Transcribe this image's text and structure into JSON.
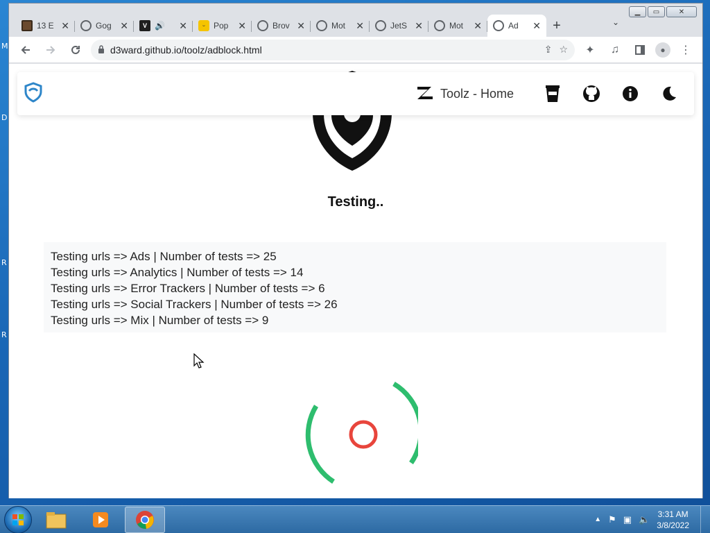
{
  "desktop": {
    "side_letters": [
      "M",
      "D",
      "R",
      "R"
    ]
  },
  "browser": {
    "tabs": [
      {
        "title": "13 E",
        "icon": "game-icon",
        "active": false
      },
      {
        "title": "Gog",
        "icon": "globe-icon",
        "active": false
      },
      {
        "title": "V",
        "icon": "vim-icon",
        "active": false
      },
      {
        "title": "Pop",
        "icon": "smile-icon",
        "active": false
      },
      {
        "title": "Brov",
        "icon": "globe-icon",
        "active": false
      },
      {
        "title": "Mot",
        "icon": "globe-icon",
        "active": false
      },
      {
        "title": "JetS",
        "icon": "globe-icon",
        "active": false
      },
      {
        "title": "Mot",
        "icon": "globe-icon",
        "active": false
      },
      {
        "title": "Ad",
        "icon": "globe-icon",
        "active": true
      }
    ],
    "url": "d3ward.github.io/toolz/adblock.html"
  },
  "page": {
    "nav": {
      "home_label": "Toolz - Home"
    },
    "status": "Testing..",
    "log": [
      "Testing urls => Ads | Number of tests => 25",
      "Testing urls => Analytics | Number of tests => 14",
      "Testing urls => Error Trackers | Number of tests => 6",
      "Testing urls => Social Trackers | Number of tests => 26",
      "Testing urls => Mix | Number of tests => 9"
    ],
    "colors": {
      "spinner_outer": "#2ebd6e",
      "spinner_inner": "#e8453c"
    }
  },
  "taskbar": {
    "time": "3:31 AM",
    "date": "3/8/2022"
  }
}
